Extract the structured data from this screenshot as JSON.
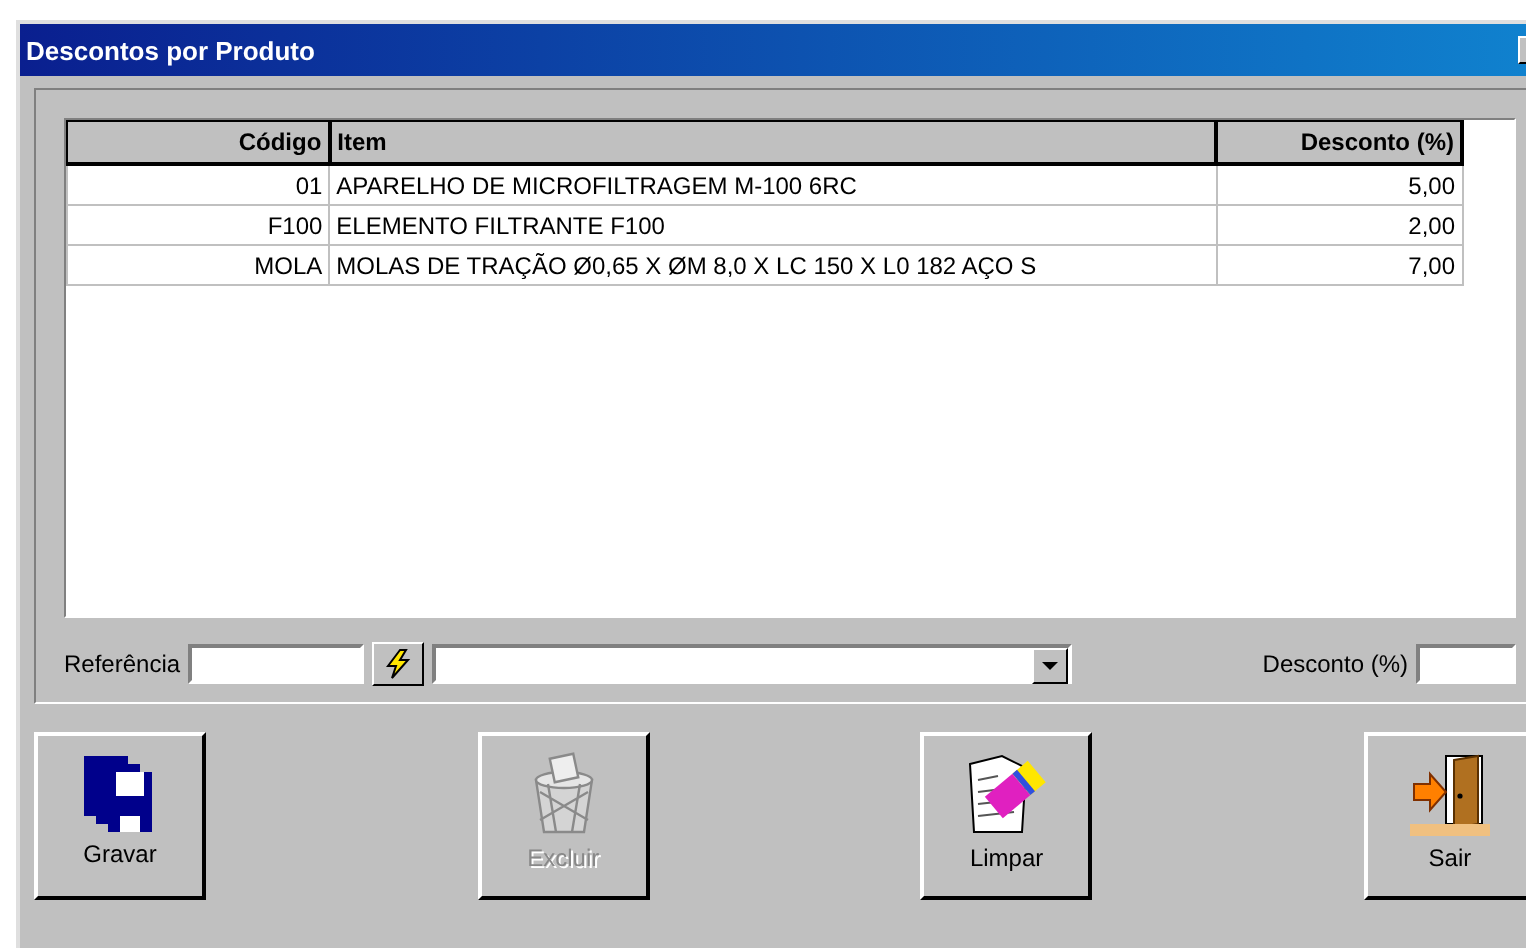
{
  "window": {
    "title": "Descontos por Produto"
  },
  "table": {
    "columns": [
      "Código",
      "Item",
      "Desconto (%)"
    ],
    "rows": [
      {
        "cells": [
          "01",
          "APARELHO DE MICROFILTRAGEM M-100 6RC",
          "5,00"
        ]
      },
      {
        "cells": [
          "F100",
          "ELEMENTO FILTRANTE F100",
          "2,00"
        ]
      },
      {
        "cells": [
          "MOLA",
          "MOLAS DE TRAÇÃO Ø0,65 X ØM 8,0 X LC 150 X L0 182 AÇO S",
          "7,00"
        ]
      }
    ]
  },
  "form": {
    "reference_label": "Referência",
    "discount_label": "Desconto (%)"
  },
  "buttons": [
    {
      "label": "Gravar",
      "disabled": false
    },
    {
      "label": "Excluir",
      "disabled": true
    },
    {
      "label": "Limpar",
      "disabled": false
    },
    {
      "label": "Sair",
      "disabled": false
    }
  ]
}
